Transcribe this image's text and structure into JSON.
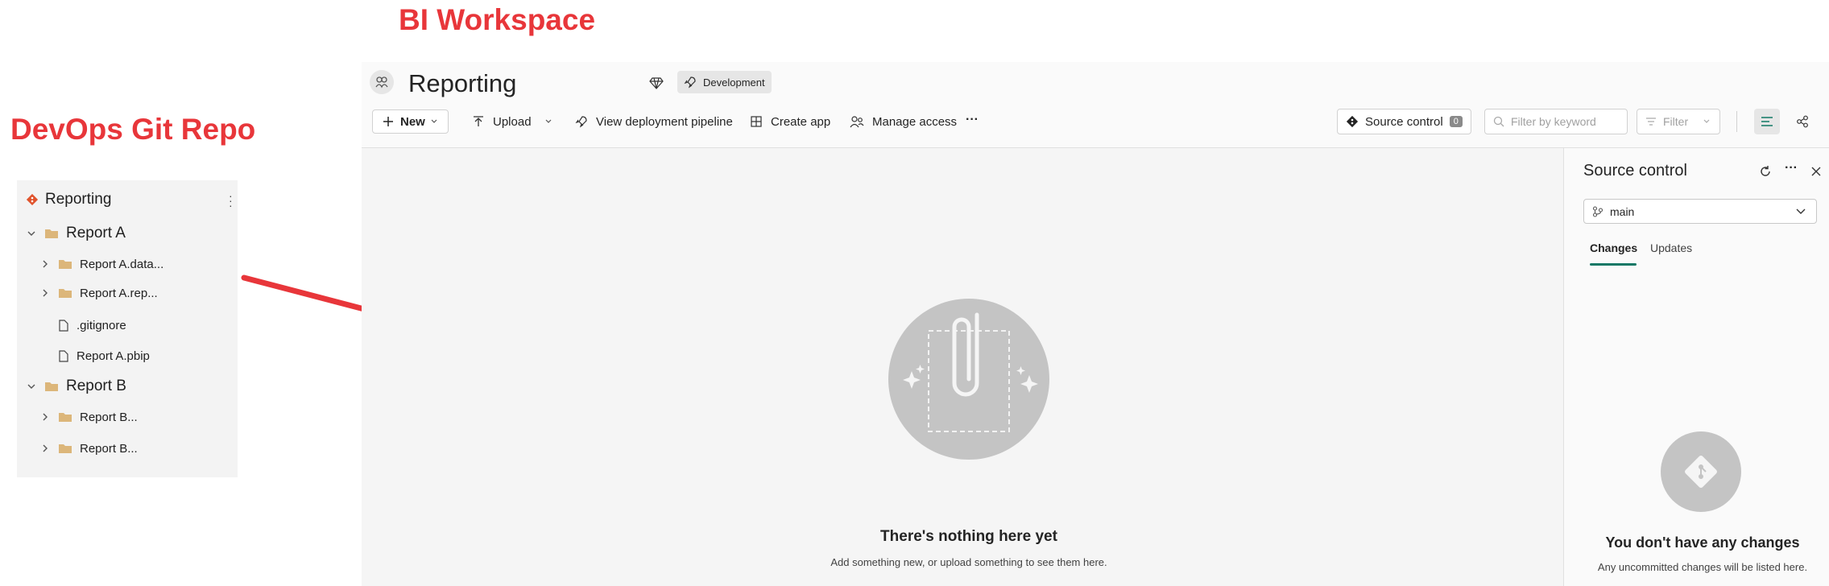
{
  "annotations": {
    "workspace_label": "BI Workspace",
    "git_label": "DevOps Git Repo",
    "label_color": "#e8363a"
  },
  "git_tree": {
    "root": "Reporting",
    "items": [
      {
        "label": "Report A",
        "type": "folder",
        "expanded": true,
        "level": 0
      },
      {
        "label": "Report A.data...",
        "type": "folder",
        "expanded": false,
        "level": 1
      },
      {
        "label": "Report A.rep...",
        "type": "folder",
        "expanded": false,
        "level": 1
      },
      {
        "label": ".gitignore",
        "type": "file",
        "level": 1
      },
      {
        "label": "Report A.pbip",
        "type": "file",
        "level": 1
      },
      {
        "label": "Report B",
        "type": "folder",
        "expanded": true,
        "level": 0
      },
      {
        "label": "Report B...",
        "type": "folder",
        "expanded": false,
        "level": 1
      },
      {
        "label": "Report B...",
        "type": "folder",
        "expanded": false,
        "level": 1
      }
    ]
  },
  "workspace": {
    "title": "Reporting",
    "env_badge": "Development",
    "toolbar": {
      "new": "New",
      "upload": "Upload",
      "pipeline": "View deployment pipeline",
      "create_app": "Create app",
      "manage_access": "Manage access",
      "more": "···"
    },
    "source_control_button": "Source control",
    "source_control_count": "0",
    "filter_placeholder": "Filter by keyword",
    "filter_button": "Filter",
    "empty_title": "There's nothing here yet",
    "empty_subtitle": "Add something new, or upload something to see them here."
  },
  "source_control": {
    "title": "Source control",
    "branch": "main",
    "tabs": [
      "Changes",
      "Updates"
    ],
    "active_tab": "Changes",
    "accent_color": "#117865",
    "empty_title": "You don't have any changes",
    "empty_subtitle": "Any uncommitted changes will be listed here."
  }
}
